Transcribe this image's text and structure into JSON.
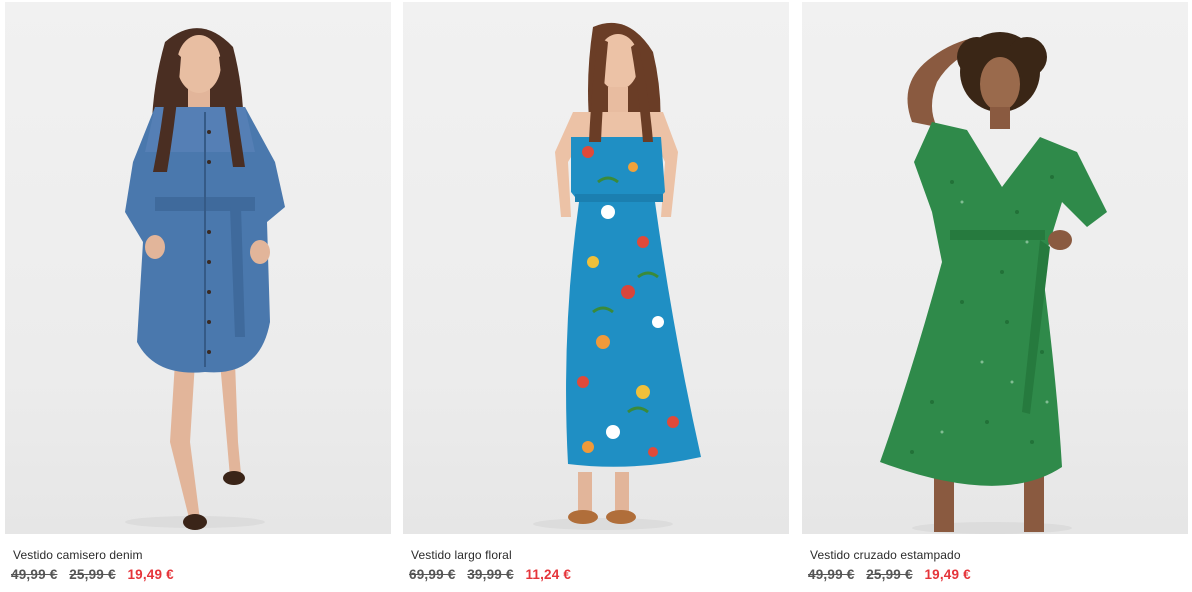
{
  "products": [
    {
      "name": "Vestido camisero denim",
      "price_original": "49,99 €",
      "price_previous": "25,99 €",
      "price_current": "19,49 €",
      "image_alt": "woman-in-denim-shirt-dress"
    },
    {
      "name": "Vestido largo floral",
      "price_original": "69,99 €",
      "price_previous": "39,99 €",
      "price_current": "11,24 €",
      "image_alt": "woman-in-blue-floral-long-dress"
    },
    {
      "name": "Vestido cruzado estampado",
      "price_original": "49,99 €",
      "price_previous": "25,99 €",
      "price_current": "19,49 €",
      "image_alt": "woman-in-green-printed-wrap-dress"
    }
  ],
  "colors": {
    "sale_price": "#e5343a",
    "old_price": "#555555",
    "photo_background": "#eeeeee",
    "denim": "#4a78ad",
    "floral_blue": "#1f8fc4",
    "green_print": "#2f8a4a"
  }
}
